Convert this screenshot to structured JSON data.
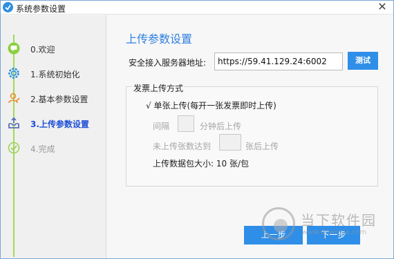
{
  "window": {
    "title": "系统参数设置",
    "app_icon": "app-logo-icon",
    "close_glyph": "✕"
  },
  "sidebar": {
    "steps": [
      {
        "label": "0.欢迎",
        "icon": "chat-bubble-icon",
        "state": "done"
      },
      {
        "label": "1.系统初始化",
        "icon": "gear-icon",
        "state": "done"
      },
      {
        "label": "2.基本参数设置",
        "icon": "user-edit-icon",
        "state": "done"
      },
      {
        "label": "3.上传参数设置",
        "icon": "upload-tray-icon",
        "state": "active"
      },
      {
        "label": "4.完成",
        "icon": "check-circle-icon",
        "state": "pending"
      }
    ]
  },
  "main": {
    "title": "上传参数设置",
    "server": {
      "label": "安全接入服务器地址:",
      "value": "https://59.41.129.24:6002",
      "test_button": "测试"
    },
    "upload_mode": {
      "group_title": "发票上传方式",
      "single_option": "√  单张上传(每开一张发票即时上传)",
      "interval_label": "间隔",
      "interval_suffix": "分钟后上传",
      "count_label": "未上传张数达到",
      "count_suffix": "张后上传",
      "packet_size": "上传数据包大小: 10 张/包"
    },
    "prev_button": "上一步",
    "next_button": "下一步"
  },
  "watermark": {
    "text": "当下软件园",
    "url": "www.downxia.com"
  },
  "colors": {
    "accent": "#2e8ee8",
    "title_blue": "#2e7fe0",
    "active_step": "#1f4fd8",
    "rail_green": "#9fd957"
  }
}
